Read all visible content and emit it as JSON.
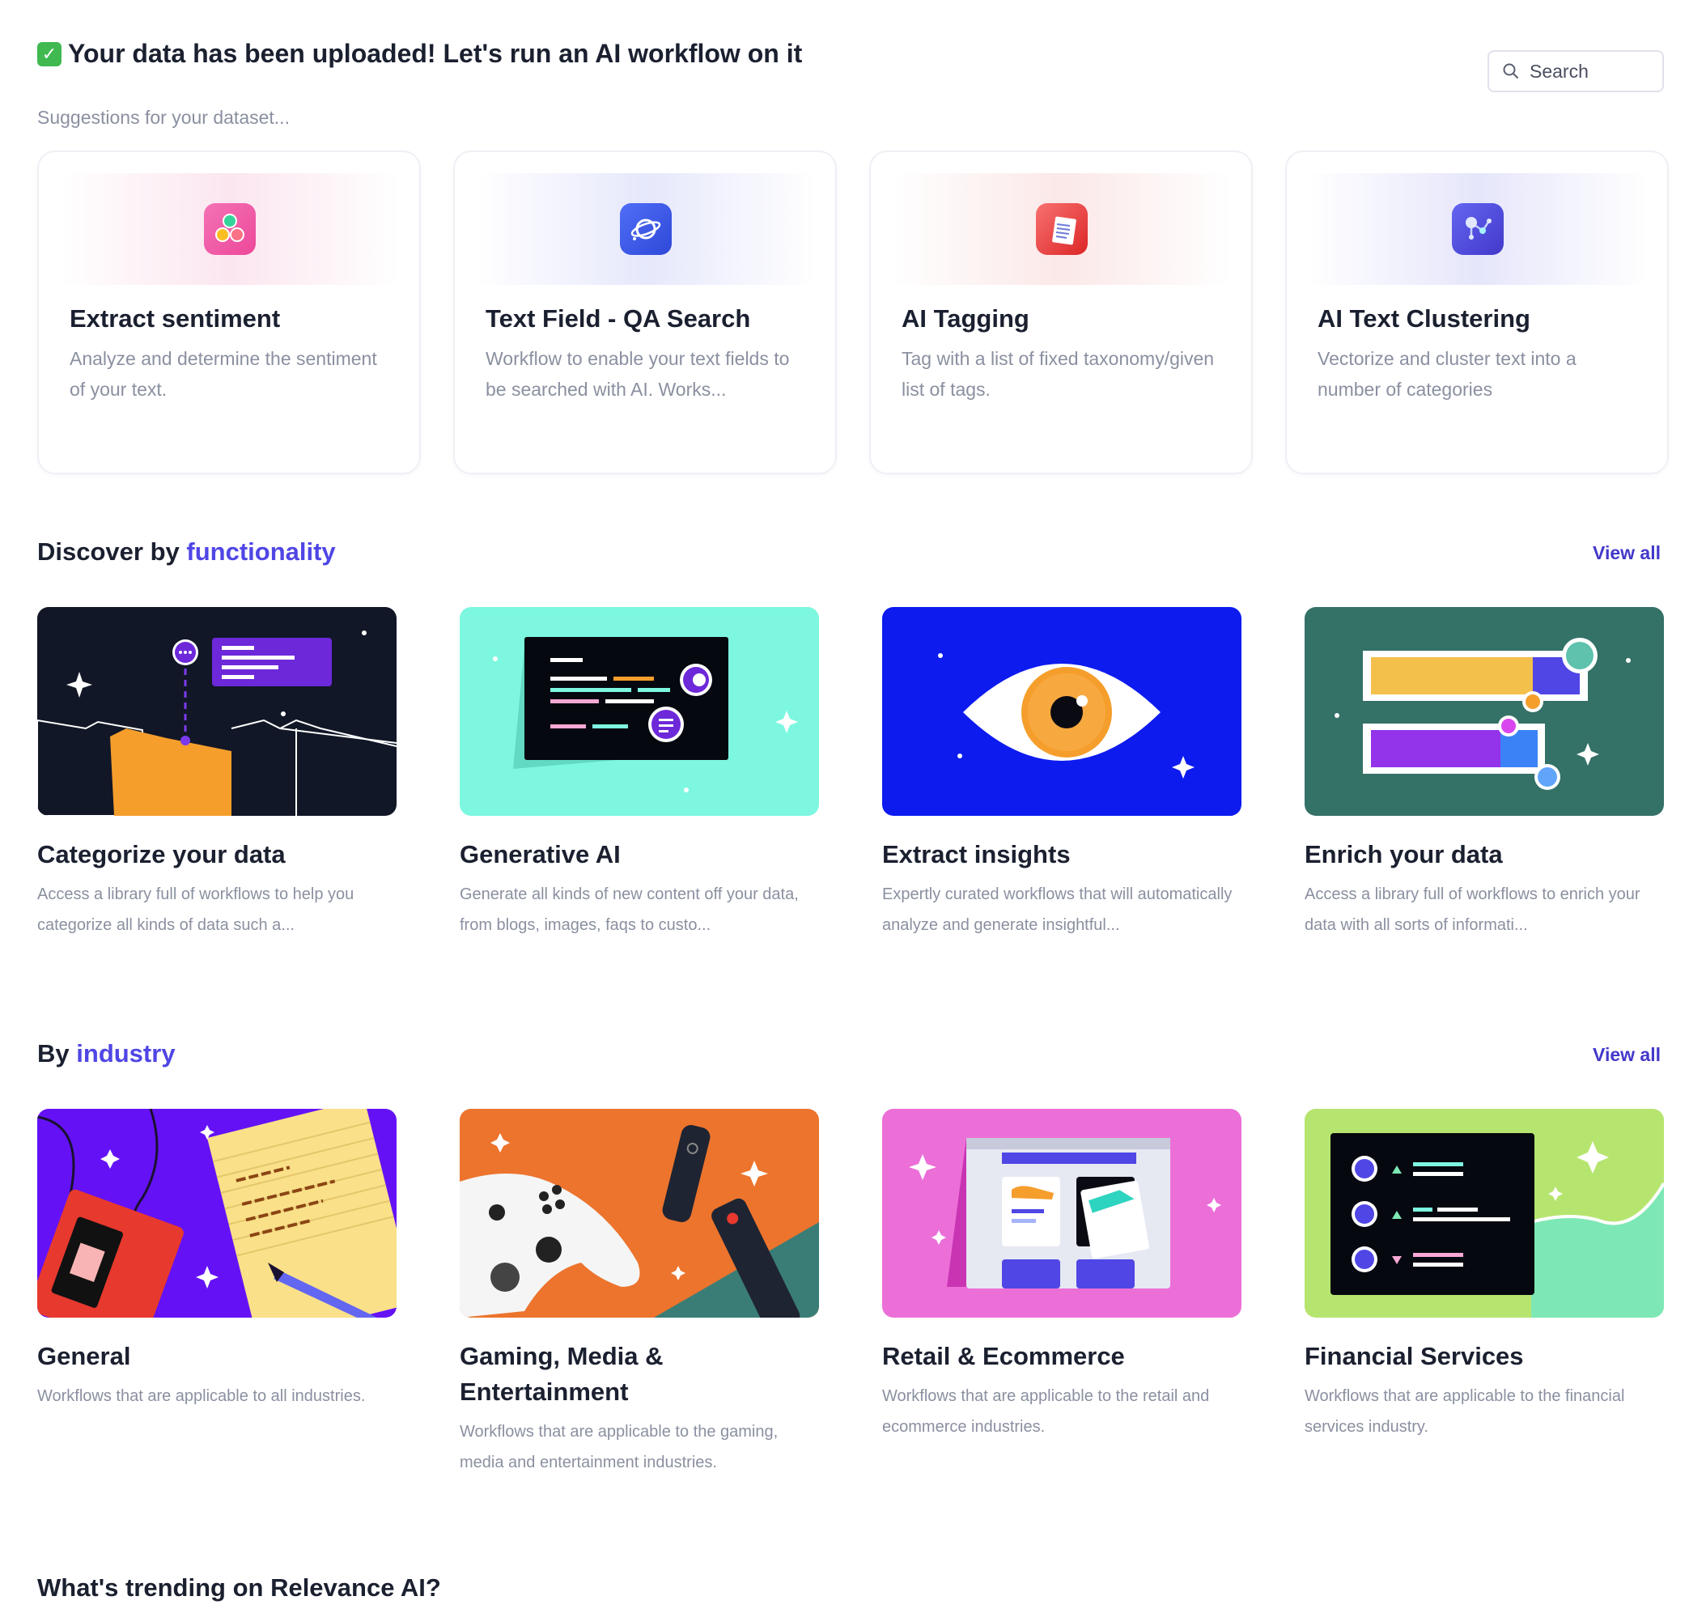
{
  "header": {
    "check": "✓",
    "title": "Your data has been uploaded! Let's run an AI workflow on it",
    "subtitle": "Suggestions for your dataset..."
  },
  "search": {
    "placeholder": "Search"
  },
  "suggestions": [
    {
      "title": "Extract sentiment",
      "description": "Analyze and determine the sentiment of your text.",
      "icon": "sentiment-icon"
    },
    {
      "title": "Text Field - QA Search",
      "description": "Workflow to enable your text fields to be searched with AI. Works...",
      "icon": "planet-search-icon"
    },
    {
      "title": "AI Tagging",
      "description": "Tag with a list of fixed taxonomy/given list of tags.",
      "icon": "document-tag-icon"
    },
    {
      "title": "AI Text Clustering",
      "description": "Vectorize and cluster text into a number of categories",
      "icon": "cluster-nodes-icon"
    }
  ],
  "functionality": {
    "prefix": "Discover by",
    "accent": "functionality",
    "view_all": "View all",
    "items": [
      {
        "title": "Categorize your data",
        "description": "Access a library full of workflows to help you categorize all kinds of data such a..."
      },
      {
        "title": "Generative AI",
        "description": "Generate all kinds of new content off your data, from blogs, images, faqs to custo..."
      },
      {
        "title": "Extract insights",
        "description": "Expertly curated workflows that will automatically analyze and generate insightful..."
      },
      {
        "title": "Enrich your data",
        "description": "Access a library full of workflows to enrich your data with all sorts of informati..."
      }
    ]
  },
  "industry": {
    "prefix": "By",
    "accent": "industry",
    "view_all": "View all",
    "items": [
      {
        "title": "General",
        "description": "Workflows that are applicable to all industries."
      },
      {
        "title": "Gaming, Media & Entertainment",
        "description": "Workflows that are applicable to the gaming, media and entertainment industries."
      },
      {
        "title": "Retail & Ecommerce",
        "description": "Workflows that are applicable to the retail and ecommerce industries."
      },
      {
        "title": "Financial Services",
        "description": "Workflows that are applicable to the financial services industry."
      }
    ]
  },
  "trending": {
    "title": "What's trending on Relevance AI?"
  },
  "colors": {
    "accent": "#4f46e5",
    "link": "#4338ca",
    "muted": "#8a90a0",
    "heading": "#1b2030"
  }
}
